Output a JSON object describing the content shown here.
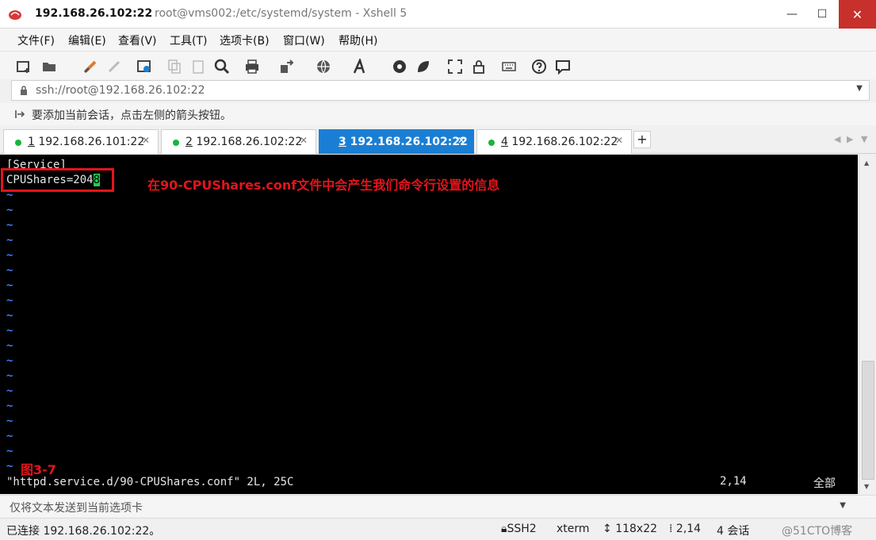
{
  "window": {
    "title_main": "192.168.26.102:22",
    "title_sub": "root@vms002:/etc/systemd/system - Xshell 5",
    "min_glyph": "—",
    "max_glyph": "☐",
    "close_glyph": "✕"
  },
  "menu": [
    "文件(F)",
    "编辑(E)",
    "查看(V)",
    "工具(T)",
    "选项卡(B)",
    "窗口(W)",
    "帮助(H)"
  ],
  "toolbar_icons": [
    "new-session-icon",
    "open-folder-icon",
    "reconnect-icon",
    "disconnect-icon",
    "properties-icon",
    "copy-icon",
    "paste-icon",
    "find-icon",
    "print-icon",
    "transfer-icon",
    "globe-icon",
    "font-icon",
    "xftp-icon",
    "xmanager-icon",
    "fullscreen-icon",
    "lock-icon",
    "keyboard-icon",
    "help-icon",
    "chat-icon"
  ],
  "address": {
    "value": "ssh://root@192.168.26.102:22"
  },
  "hint": {
    "text": "要添加当前会话，点击左侧的箭头按钮。"
  },
  "tabs": [
    {
      "num": "1",
      "label": " 192.168.26.101:22",
      "active": false
    },
    {
      "num": "2",
      "label": " 192.168.26.102:22",
      "active": false
    },
    {
      "num": "3",
      "label": " 192.168.26.102:22",
      "active": true
    },
    {
      "num": "4",
      "label": " 192.168.26.102:22",
      "active": false
    }
  ],
  "tab_add_label": "+",
  "terminal": {
    "line1": "[Service]",
    "line2_prefix": "CPUShares=204",
    "line2_cursor": "8",
    "tilde": "~",
    "status_file": "\"httpd.service.d/90-CPUShares.conf\" 2L, 25C",
    "status_pos": "2,14",
    "status_all": "全部"
  },
  "annotations": {
    "main": "在90-CPUShares.conf文件中会产生我们命令行设置的信息",
    "figure": "图3-7"
  },
  "sendbar": {
    "placeholder": "仅将文本发送到当前选项卡"
  },
  "statusbar": {
    "connected": "已连接 192.168.26.102:22。",
    "protocol": "SSH2",
    "term": "xterm",
    "size": "118x22",
    "cursor": "2,14",
    "sessions": "4 会话",
    "watermark": "@51CTO博客"
  },
  "colors": {
    "annotation_red": "#e3141b",
    "tab_active": "#1a7fd4",
    "status_dot": "#19b53a",
    "cursor_green": "#19d44a",
    "tilde_blue": "#3d7dff"
  }
}
